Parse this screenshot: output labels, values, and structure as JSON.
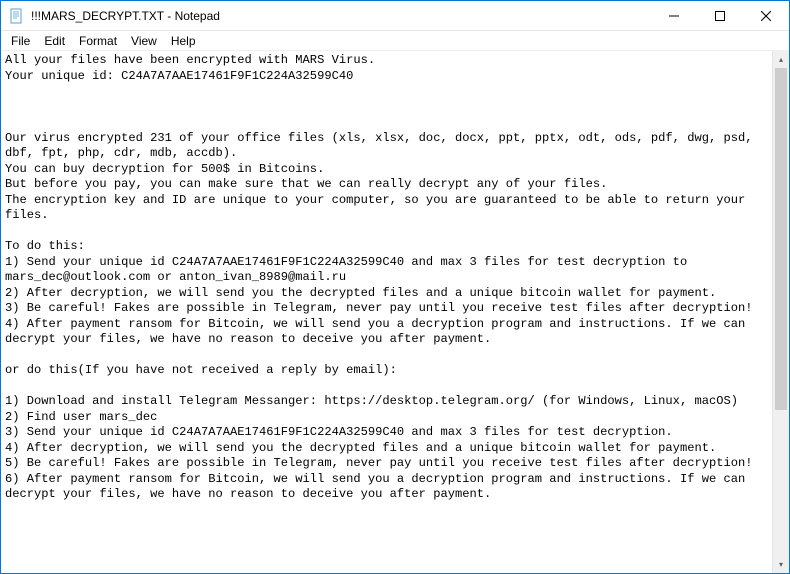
{
  "window": {
    "title": "!!!MARS_DECRYPT.TXT - Notepad"
  },
  "menubar": {
    "file": "File",
    "edit": "Edit",
    "format": "Format",
    "view": "View",
    "help": "Help"
  },
  "content": {
    "text": "All your files have been encrypted with MARS Virus.\nYour unique id: C24A7A7AAE17461F9F1C224A32599C40\n\n\n\nOur virus encrypted 231 of your office files (xls, xlsx, doc, docx, ppt, pptx, odt, ods, pdf, dwg, psd, dbf, fpt, php, cdr, mdb, accdb).\nYou can buy decryption for 500$ in Bitcoins.\nBut before you pay, you can make sure that we can really decrypt any of your files.\nThe encryption key and ID are unique to your computer, so you are guaranteed to be able to return your files.\n\nTo do this:\n1) Send your unique id C24A7A7AAE17461F9F1C224A32599C40 and max 3 files for test decryption to mars_dec@outlook.com or anton_ivan_8989@mail.ru\n2) After decryption, we will send you the decrypted files and a unique bitcoin wallet for payment.\n3) Be careful! Fakes are possible in Telegram, never pay until you receive test files after decryption!\n4) After payment ransom for Bitcoin, we will send you a decryption program and instructions. If we can decrypt your files, we have no reason to deceive you after payment.\n\nor do this(If you have not received a reply by email):\n\n1) Download and install Telegram Messanger: https://desktop.telegram.org/ (for Windows, Linux, macOS)\n2) Find user mars_dec\n3) Send your unique id C24A7A7AAE17461F9F1C224A32599C40 and max 3 files for test decryption.\n4) After decryption, we will send you the decrypted files and a unique bitcoin wallet for payment.\n5) Be careful! Fakes are possible in Telegram, never pay until you receive test files after decryption!\n6) After payment ransom for Bitcoin, we will send you a decryption program and instructions. If we can decrypt your files, we have no reason to deceive you after payment."
  }
}
